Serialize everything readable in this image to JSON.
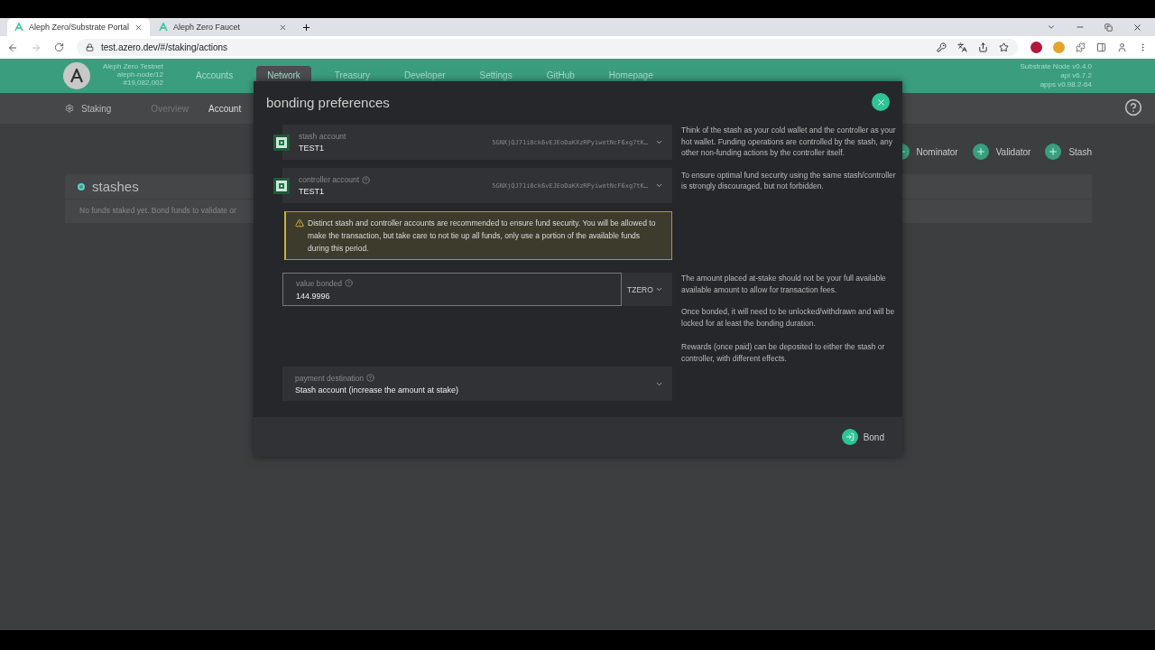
{
  "browser": {
    "tabs": [
      {
        "title": "Aleph Zero/Substrate Portal",
        "selected": true
      },
      {
        "title": "Aleph Zero Faucet",
        "selected": false
      }
    ],
    "url": "test.azero.dev/#/staking/actions"
  },
  "header": {
    "chain": "Aleph Zero Testnet",
    "node": "aleph-node/12",
    "block": "#19,082,002",
    "nav": [
      {
        "label": "Accounts",
        "selected": false
      },
      {
        "label": "Network",
        "selected": true
      },
      {
        "label": "Treasury",
        "selected": false
      },
      {
        "label": "Developer",
        "selected": false
      },
      {
        "label": "Settings",
        "selected": false
      },
      {
        "label": "GitHub",
        "selected": false
      },
      {
        "label": "Homepage",
        "selected": false
      }
    ],
    "versions": [
      "Substrate Node v0.4.0",
      "api v6.7.2",
      "apps v0.98.2-64"
    ]
  },
  "subnav": {
    "section": "Staking",
    "tabs": [
      {
        "label": "Overview",
        "selected": false
      },
      {
        "label": "Account",
        "selected": true
      }
    ]
  },
  "actions": [
    "Nominator",
    "Validator",
    "Stash"
  ],
  "stashes": {
    "title": "stashes",
    "empty": "No funds staked yet. Bond funds to validate or"
  },
  "modal": {
    "title": "bonding preferences",
    "accounts": [
      {
        "label": "stash account",
        "help": false,
        "name": "TEST1",
        "address": "5GNXjQJ71i8ck6vEJEoDaKXzRPyiwetNcF6xg7tK…"
      },
      {
        "label": "controller account",
        "help": true,
        "name": "TEST1",
        "address": "5GNXjQJ71i8ck6vEJEoDaKXzRPyiwetNcF6xg7tK…"
      }
    ],
    "warning": "Distinct stash and controller accounts are recommended to ensure fund security. You will be allowed to make the transaction, but take care to not tie up all funds, only use a portion of the available funds during this period.",
    "amount": {
      "label": "value bonded",
      "value": "144.9996",
      "unit": "TZERO"
    },
    "payment": {
      "label": "payment destination",
      "value": "Stash account (increase the amount at stake)"
    },
    "help": [
      [
        "Think of the stash as your cold wallet and the controller as your hot wallet. Funding operations are controlled by the stash, any other non-funding actions by the controller itself.",
        "To ensure optimal fund security using the same stash/controller is strongly discouraged, but not forbidden."
      ],
      [
        "The amount placed at-stake should not be your full available available amount to allow for transaction fees.",
        "Once bonded, it will need to be unlocked/withdrawn and will be locked for at least the bonding duration."
      ],
      [
        "Rewards (once paid) can be deposited to either the stash or controller, with different effects."
      ]
    ],
    "bond": "Bond"
  }
}
